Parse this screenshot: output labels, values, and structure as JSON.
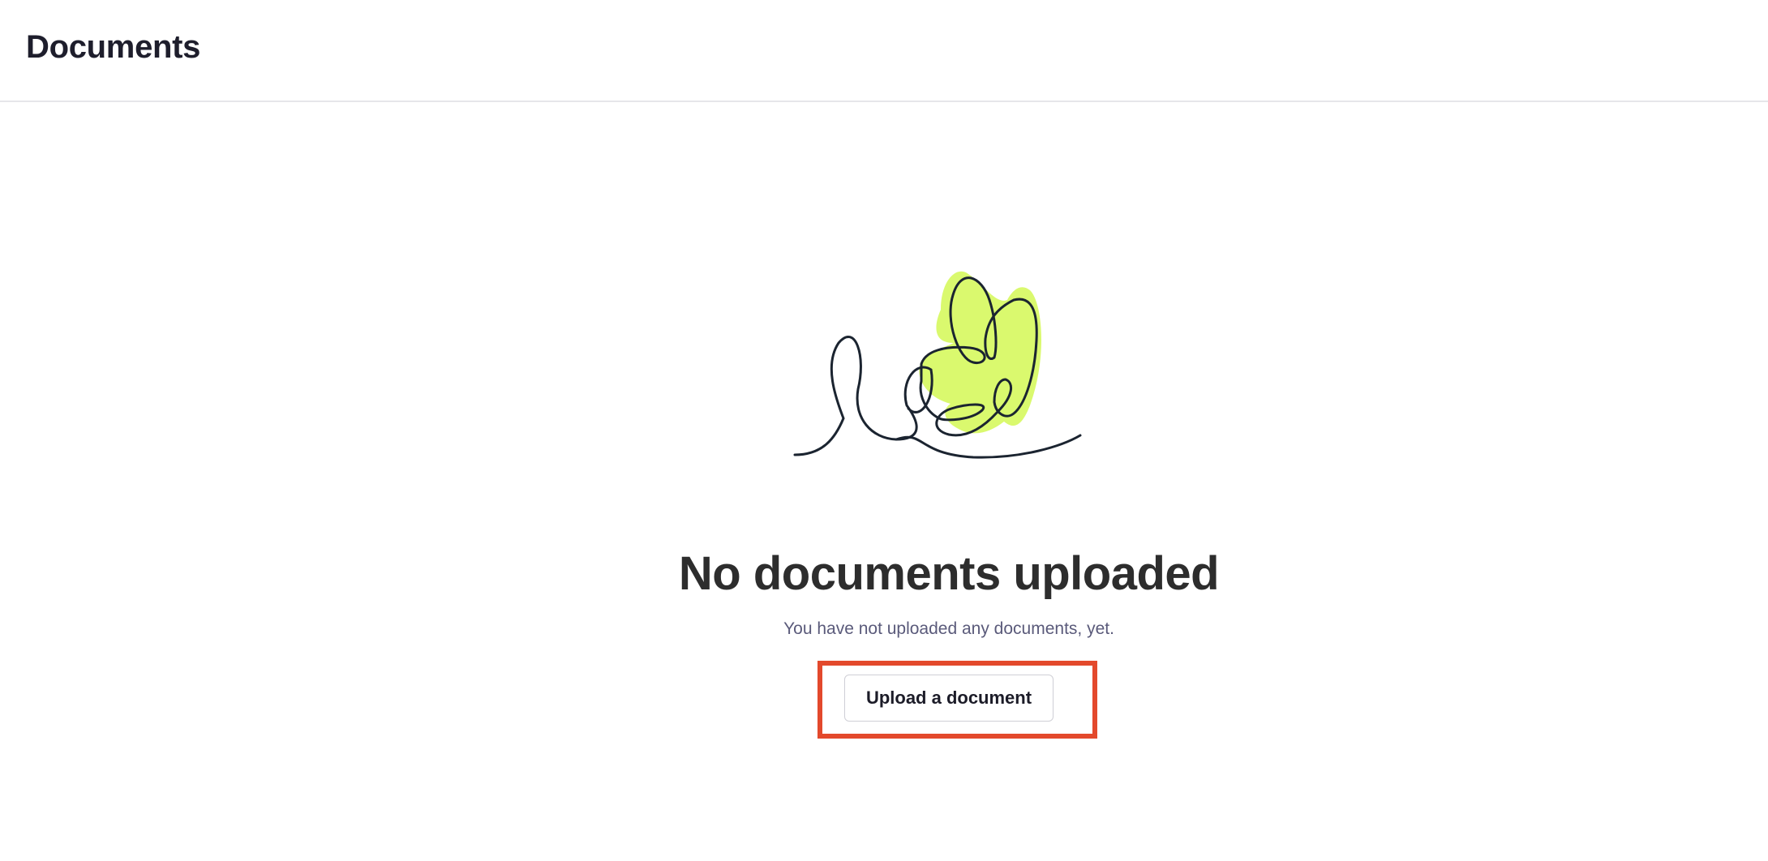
{
  "header": {
    "title": "Documents"
  },
  "empty_state": {
    "illustration_icon": "scribble-leaf-illustration-icon",
    "title": "No documents uploaded",
    "subtitle": "You have not uploaded any documents, yet.",
    "upload_button_label": "Upload a document"
  },
  "colors": {
    "accent_fill": "#daf96e",
    "stroke": "#1b2430",
    "highlight": "#e3492c"
  }
}
